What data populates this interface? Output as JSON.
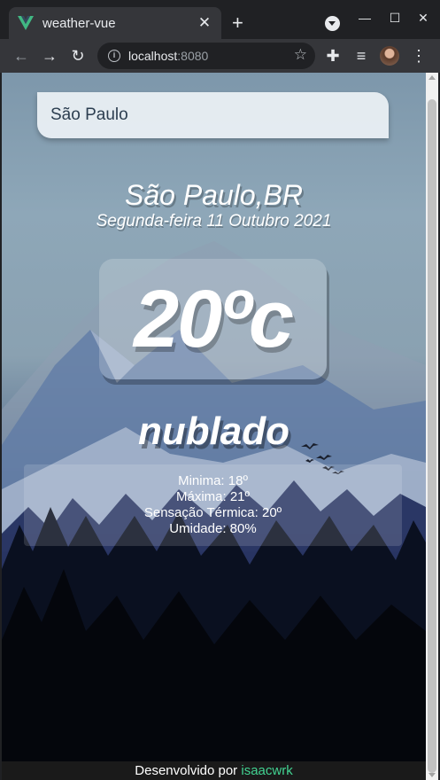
{
  "browser": {
    "tab_title": "weather-vue",
    "tab_close": "✕",
    "new_tab": "+",
    "url_host": "localhost",
    "url_port": ":8080",
    "window_controls": {
      "minimize": "—",
      "maximize": "☐",
      "close": "✕"
    },
    "icons": [
      "back-icon",
      "forward-icon",
      "reload-icon",
      "info-icon",
      "star-icon",
      "extensions-icon",
      "media-icon",
      "avatar",
      "menu-icon"
    ],
    "favicon_color": "#41b883"
  },
  "search": {
    "value": "São Paulo"
  },
  "weather": {
    "location": "São Paulo,BR",
    "date": "Segunda-feira 11 Outubro 2021",
    "temperature": "20ºc",
    "condition": "nublado",
    "details": {
      "min": "Minima: 18º",
      "max": "Máxima: 21º",
      "feels_like": "Sensação Térmica: 20º",
      "humidity": "Umidade: 80%"
    }
  },
  "footer": {
    "prefix": "Desenvolvido por",
    "author": "isaacwrk",
    "author_color": "#42d392"
  }
}
